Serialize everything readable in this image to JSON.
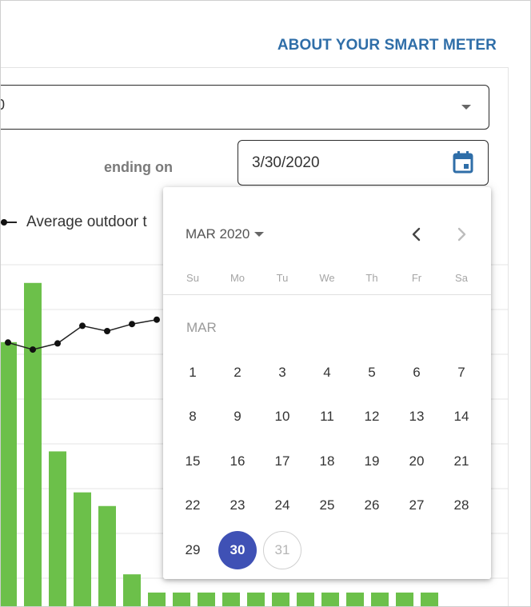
{
  "header": {
    "about_link": "ABOUT YOUR SMART METER"
  },
  "controls": {
    "period_select_value": "0",
    "ending_label": "ending on",
    "date_value": "3/30/2020"
  },
  "legend": {
    "label": "Average outdoor t"
  },
  "calendar": {
    "month_year": "MAR 2020",
    "weekdays": [
      "Su",
      "Mo",
      "Tu",
      "We",
      "Th",
      "Fr",
      "Sa"
    ],
    "month_label": "MAR",
    "days": [
      "1",
      "2",
      "3",
      "4",
      "5",
      "6",
      "7",
      "8",
      "9",
      "10",
      "11",
      "12",
      "13",
      "14",
      "15",
      "16",
      "17",
      "18",
      "19",
      "20",
      "21",
      "22",
      "23",
      "24",
      "25",
      "26",
      "27",
      "28",
      "29",
      "30",
      "31"
    ],
    "selected_day": "30",
    "today_day": "31"
  },
  "colors": {
    "accent": "#3f51b5",
    "link": "#2f6ea8",
    "bar": "#6cc04a"
  },
  "chart_data": {
    "type": "bar",
    "bar_values": [
      58,
      71,
      34,
      25,
      22,
      7,
      3,
      3,
      3,
      3,
      3,
      3,
      3,
      3,
      3,
      3,
      3,
      3
    ],
    "line_values": [
      4.7,
      3.9,
      4.6,
      6.6,
      6.0,
      6.8,
      7.3
    ]
  }
}
